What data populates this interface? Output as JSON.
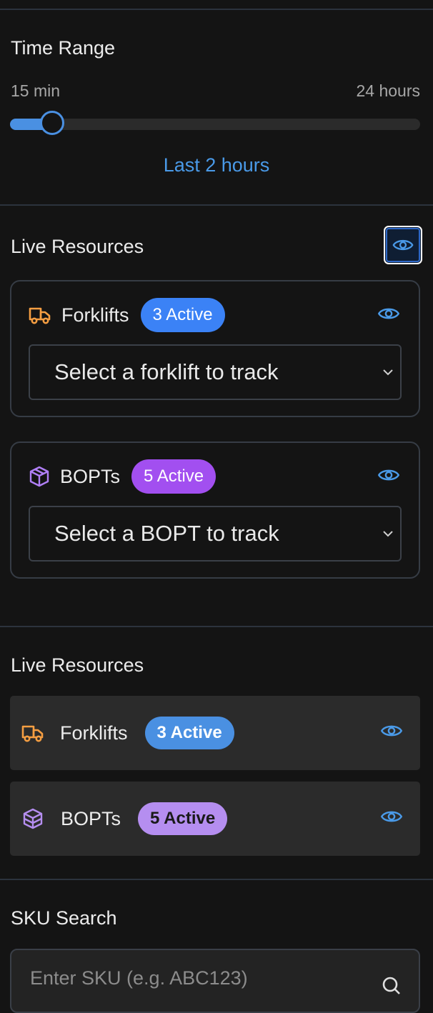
{
  "time_range": {
    "title": "Time Range",
    "min_label": "15 min",
    "max_label": "24 hours",
    "value_label": "Last 2 hours",
    "slider_fraction": 0.102
  },
  "live_resources_panel": {
    "title": "Live Resources",
    "visibility_icon": "eye-icon",
    "forklifts": {
      "icon": "truck-icon",
      "label": "Forklifts",
      "badge": "3 Active",
      "badge_color": "#3b82f6",
      "select_placeholder": "Select a forklift to track",
      "accent": "#f59e42"
    },
    "bopts": {
      "icon": "package-icon",
      "label": "BOPTs",
      "badge": "5 Active",
      "badge_color": "#a24ff0",
      "select_placeholder": "Select a BOPT to track",
      "accent": "#b07ff6"
    }
  },
  "live_resources_list": {
    "title": "Live Resources",
    "items": [
      {
        "icon": "truck-icon",
        "label": "Forklifts",
        "badge": "3 Active",
        "badge_color": "#4a90e2"
      },
      {
        "icon": "package-icon",
        "label": "BOPTs",
        "badge": "5 Active",
        "badge_color": "#b58ef0"
      }
    ]
  },
  "sku_search": {
    "title": "SKU Search",
    "placeholder": "Enter SKU (e.g. ABC123)",
    "icon": "search-icon"
  },
  "colors": {
    "accent": "#4a90e2",
    "background": "#141414"
  }
}
